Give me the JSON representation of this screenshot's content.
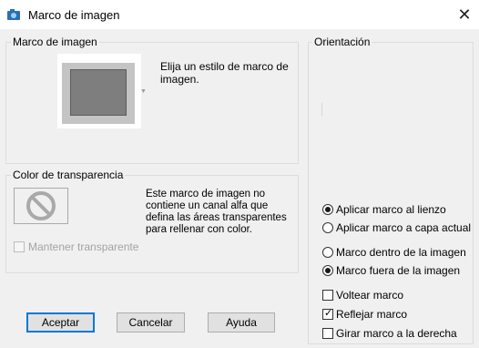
{
  "window": {
    "title": "Marco de imagen"
  },
  "frame_group": {
    "label": "Marco de imagen",
    "description": "Elija un estilo de marco de imagen."
  },
  "transparency_group": {
    "label": "Color de transparencia",
    "description": "Este marco de imagen no contiene un canal alfa que defina las áreas transparentes para rellenar con color.",
    "keep_transparent": {
      "label": "Mantener transparente",
      "checked": false,
      "enabled": false
    }
  },
  "orientation_group": {
    "label": "Orientación",
    "apply_radios": [
      {
        "label": "Aplicar marco al lienzo",
        "selected": true
      },
      {
        "label": "Aplicar marco a capa actual",
        "selected": false
      }
    ],
    "position_radios": [
      {
        "label": "Marco dentro de la imagen",
        "selected": false
      },
      {
        "label": "Marco fuera de la imagen",
        "selected": true
      }
    ],
    "checkboxes": [
      {
        "label": "Voltear marco",
        "checked": false
      },
      {
        "label": "Reflejar marco",
        "checked": true
      },
      {
        "label": "Girar marco a la derecha",
        "checked": false
      }
    ]
  },
  "buttons": {
    "ok": "Aceptar",
    "cancel": "Cancelar",
    "help": "Ayuda"
  },
  "colors": {
    "default_button_border": "#0078d7",
    "preview_frame": "#c4c4c4",
    "preview_picture": "#7e7e7e"
  },
  "icons": {
    "app": "frame-app-icon",
    "close": "close-icon",
    "no_transparency": "no-symbol-icon"
  }
}
